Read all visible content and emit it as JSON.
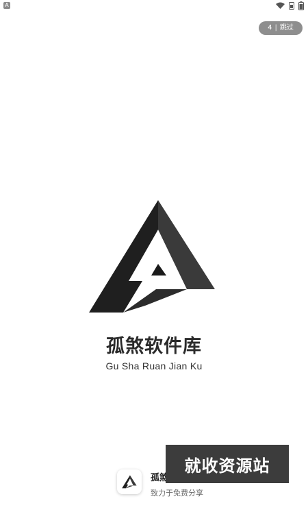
{
  "status_bar": {
    "app_icon": "A",
    "icons": [
      "wifi-icon",
      "sim-icon",
      "battery-icon"
    ]
  },
  "skip": {
    "count": "4",
    "separator": "|",
    "label": "跳过"
  },
  "brand": {
    "name": "孤煞软件库",
    "pinyin": "Gu Sha Ruan Jian Ku",
    "logo": "triangle-a-logo"
  },
  "footer": {
    "app_name": "孤煞",
    "tagline": "致力于免费分享"
  },
  "watermark": {
    "text": "就收资源站"
  },
  "colors": {
    "logo_dark": "#1f1f1f",
    "logo_mid": "#3a3a3a",
    "skip_bg": "#8e8e8e",
    "watermark_bg": "#3c3c3c"
  }
}
